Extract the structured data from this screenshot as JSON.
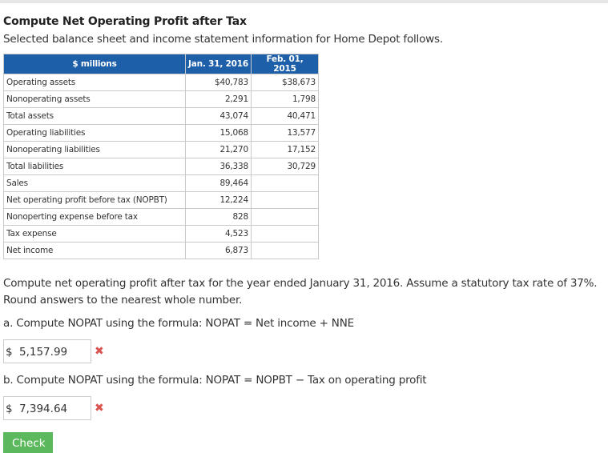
{
  "title": "Compute Net Operating Profit after Tax",
  "subtitle": "Selected balance sheet and income statement information for Home Depot follows.",
  "table": {
    "headers": [
      "$ millions",
      "Jan. 31, 2016",
      "Feb. 01, 2015"
    ],
    "rows": [
      [
        "Operating assets",
        "$40,783",
        "$38,673"
      ],
      [
        "Nonoperating assets",
        "2,291",
        "1,798"
      ],
      [
        "Total assets",
        "43,074",
        "40,471"
      ],
      [
        "Operating liabilities",
        "15,068",
        "13,577"
      ],
      [
        "Nonoperating liabilities",
        "21,270",
        "17,152"
      ],
      [
        "Total liabilities",
        "36,338",
        "30,729"
      ],
      [
        "Sales",
        "89,464",
        ""
      ],
      [
        "Net operating profit before tax (NOPBT)",
        "12,224",
        ""
      ],
      [
        "Nonoperting expense before tax",
        "828",
        ""
      ],
      [
        "Tax expense",
        "4,523",
        ""
      ],
      [
        "Net income",
        "6,873",
        ""
      ]
    ]
  },
  "question": "Compute net operating profit after tax for the year ended January 31, 2016. Assume a statutory tax rate of 37%. Round answers to the nearest whole number.",
  "part_a": {
    "label": "a. Compute NOPAT using the formula: NOPAT = Net income + NNE",
    "currency": "$",
    "value": "5,157.99",
    "status_icon": "incorrect-x-icon",
    "status_glyph": "✖"
  },
  "part_b": {
    "label": "b. Compute NOPAT using the formula: NOPAT = NOPBT − Tax on operating profit",
    "currency": "$",
    "value": "7,394.64",
    "status_icon": "incorrect-x-icon",
    "status_glyph": "✖"
  },
  "check_button": "Check",
  "colors": {
    "header_bg": "#1d5fa8",
    "incorrect": "#d9534f",
    "check_bg": "#5cb85c"
  }
}
